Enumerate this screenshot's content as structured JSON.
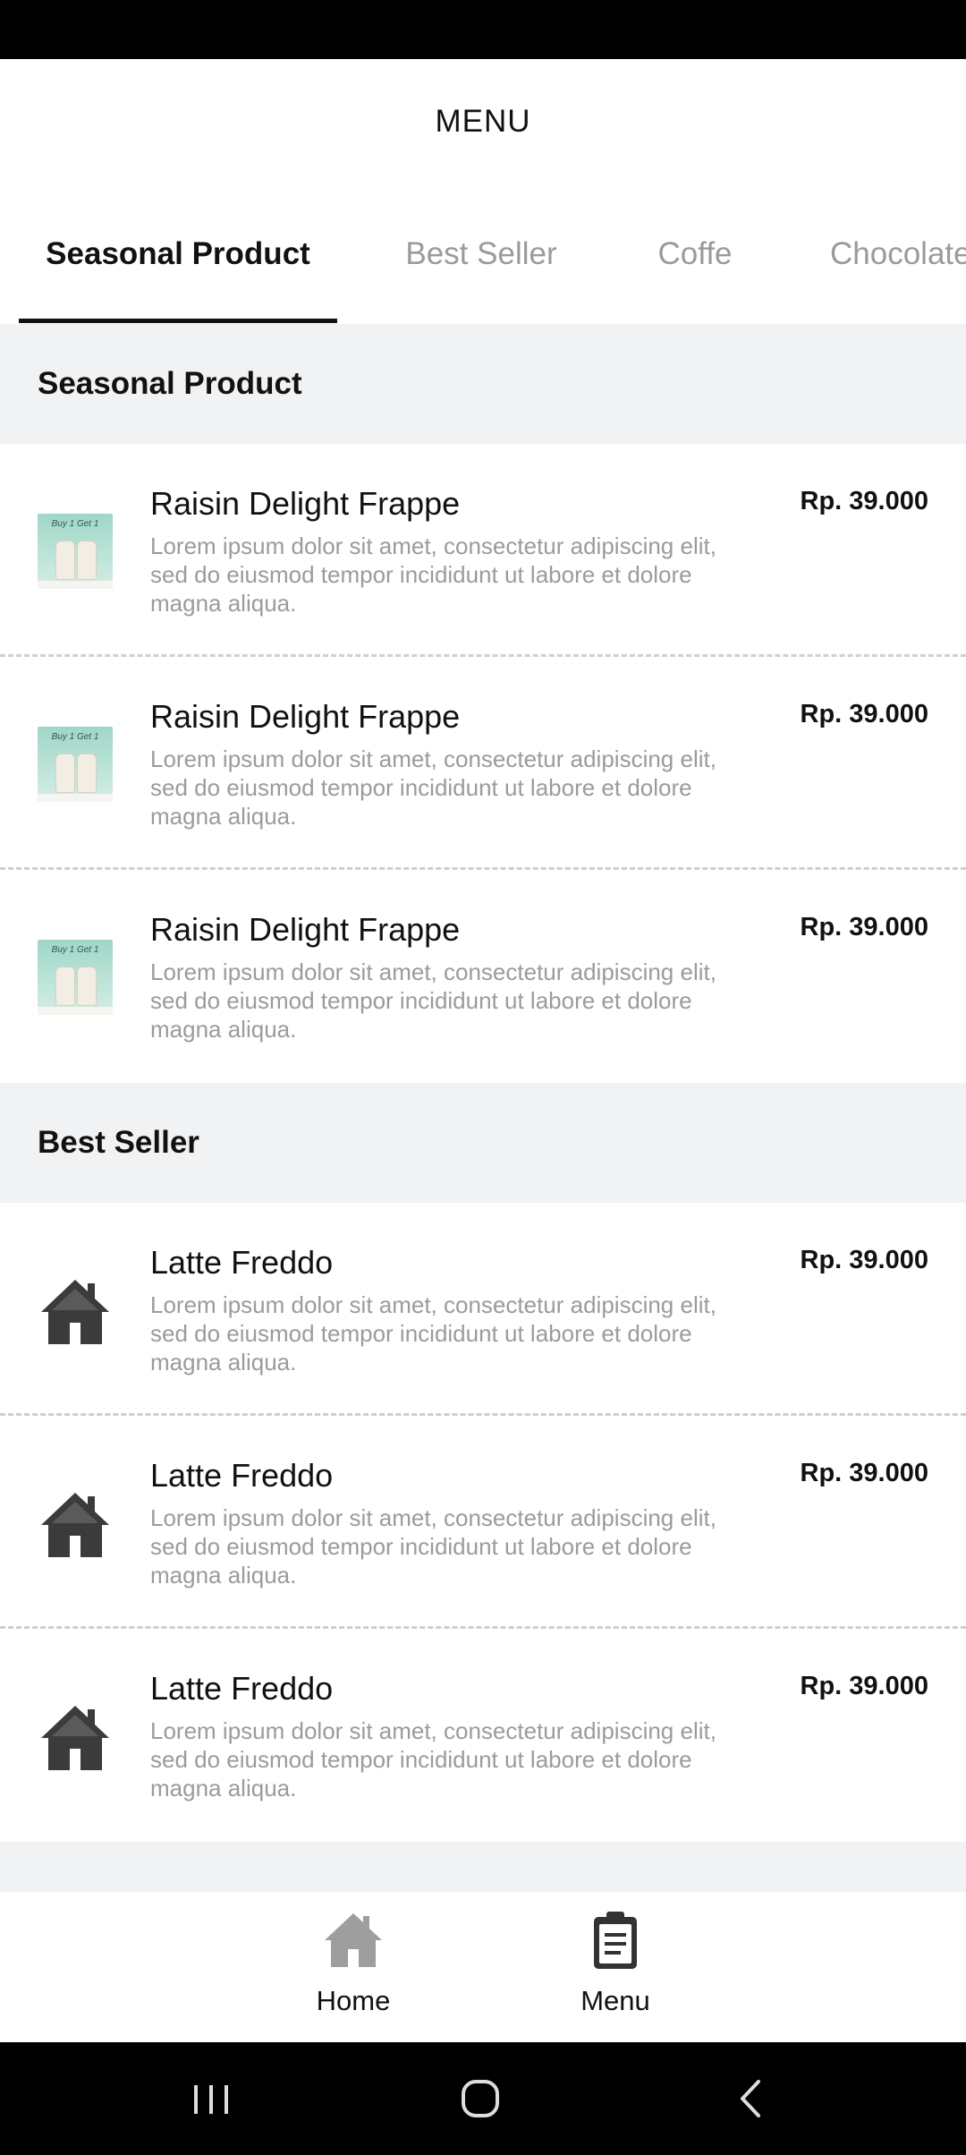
{
  "app": {
    "title": "MENU"
  },
  "tabs": [
    {
      "label": "Seasonal Product",
      "active": true
    },
    {
      "label": "Best Seller",
      "active": false
    },
    {
      "label": "Coffe",
      "active": false
    },
    {
      "label": "Chocolate",
      "active": false
    }
  ],
  "sections": [
    {
      "title": "Seasonal Product",
      "items": [
        {
          "name": "Raisin Delight Frappe",
          "price": "Rp. 39.000",
          "description": "Lorem ipsum dolor sit amet, consectetur adipiscing elit, sed do eiusmod tempor incididunt ut labore et dolore magna aliqua.",
          "image": "frappe-promo-image",
          "image_text": "Buy 1 Get 1"
        },
        {
          "name": "Raisin Delight Frappe",
          "price": "Rp. 39.000",
          "description": "Lorem ipsum dolor sit amet, consectetur adipiscing elit, sed do eiusmod tempor incididunt ut labore et dolore magna aliqua.",
          "image": "frappe-promo-image",
          "image_text": "Buy 1 Get 1"
        },
        {
          "name": "Raisin Delight Frappe",
          "price": "Rp. 39.000",
          "description": "Lorem ipsum dolor sit amet, consectetur adipiscing elit, sed do eiusmod tempor incididunt ut labore et dolore magna aliqua.",
          "image": "frappe-promo-image",
          "image_text": "Buy 1 Get 1"
        }
      ]
    },
    {
      "title": "Best Seller",
      "items": [
        {
          "name": "Latte Freddo",
          "price": "Rp. 39.000",
          "description": "Lorem ipsum dolor sit amet, consectetur adipiscing elit, sed do eiusmod tempor incididunt ut labore et dolore magna aliqua.",
          "image": "house-icon"
        },
        {
          "name": "Latte Freddo",
          "price": "Rp. 39.000",
          "description": "Lorem ipsum dolor sit amet, consectetur adipiscing elit, sed do eiusmod tempor incididunt ut labore et dolore magna aliqua.",
          "image": "house-icon"
        },
        {
          "name": "Latte Freddo",
          "price": "Rp. 39.000",
          "description": "Lorem ipsum dolor sit amet, consectetur adipiscing elit, sed do eiusmod tempor incididunt ut labore et dolore magna aliqua.",
          "image": "house-icon"
        }
      ]
    }
  ],
  "bottom_nav": [
    {
      "label": "Home",
      "icon": "home-icon",
      "active": false
    },
    {
      "label": "Menu",
      "icon": "clipboard-icon",
      "active": true
    }
  ],
  "system_nav": [
    {
      "icon": "recent-apps-icon"
    },
    {
      "icon": "home-circle-icon"
    },
    {
      "icon": "back-icon"
    }
  ],
  "colors": {
    "section_bg": "#f1f2f4",
    "text_primary": "#111111",
    "text_secondary": "#9b9b9b",
    "inactive_icon": "#9e9e9e",
    "active_icon": "#333333"
  }
}
